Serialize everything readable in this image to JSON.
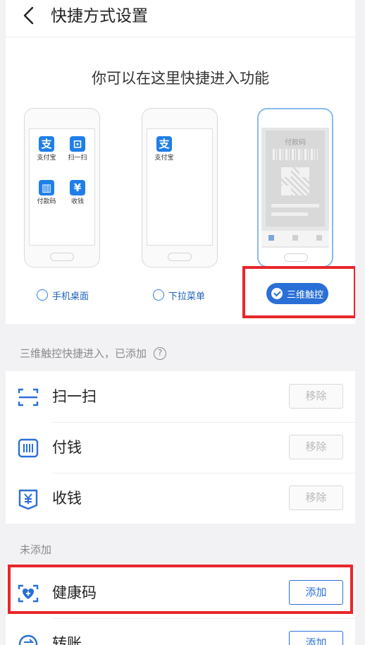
{
  "header": {
    "title": "快捷方式设置"
  },
  "select": {
    "heading": "你可以在这里快捷进入功能",
    "options": [
      {
        "label": "手机桌面",
        "selected": false
      },
      {
        "label": "下拉菜单",
        "selected": false
      },
      {
        "label": "三维触控",
        "selected": true
      }
    ],
    "phone1_apps": [
      {
        "label": "支付宝",
        "glyph": "支"
      },
      {
        "label": "扫一扫",
        "glyph": "⊡"
      },
      {
        "label": "付款码",
        "glyph": "▥"
      },
      {
        "label": "收钱",
        "glyph": "¥"
      }
    ],
    "phone2_apps": [
      {
        "label": "支付宝",
        "glyph": "支"
      }
    ],
    "phone3_title": "付款码"
  },
  "added": {
    "label": "三维触控快捷进入，已添加",
    "help_glyph": "?",
    "items": [
      {
        "label": "扫一扫",
        "action": "移除",
        "icon": "scan-icon"
      },
      {
        "label": "付钱",
        "action": "移除",
        "icon": "pay-code-icon"
      },
      {
        "label": "收钱",
        "action": "移除",
        "icon": "receive-money-icon"
      }
    ]
  },
  "not_added": {
    "label": "未添加",
    "items": [
      {
        "label": "健康码",
        "action": "添加",
        "icon": "health-code-icon"
      },
      {
        "label": "转账",
        "action": "添加",
        "icon": "transfer-icon"
      }
    ]
  },
  "colors": {
    "accent": "#2a6fd6",
    "highlight": "#e8262c",
    "background": "#f2f2f5"
  }
}
